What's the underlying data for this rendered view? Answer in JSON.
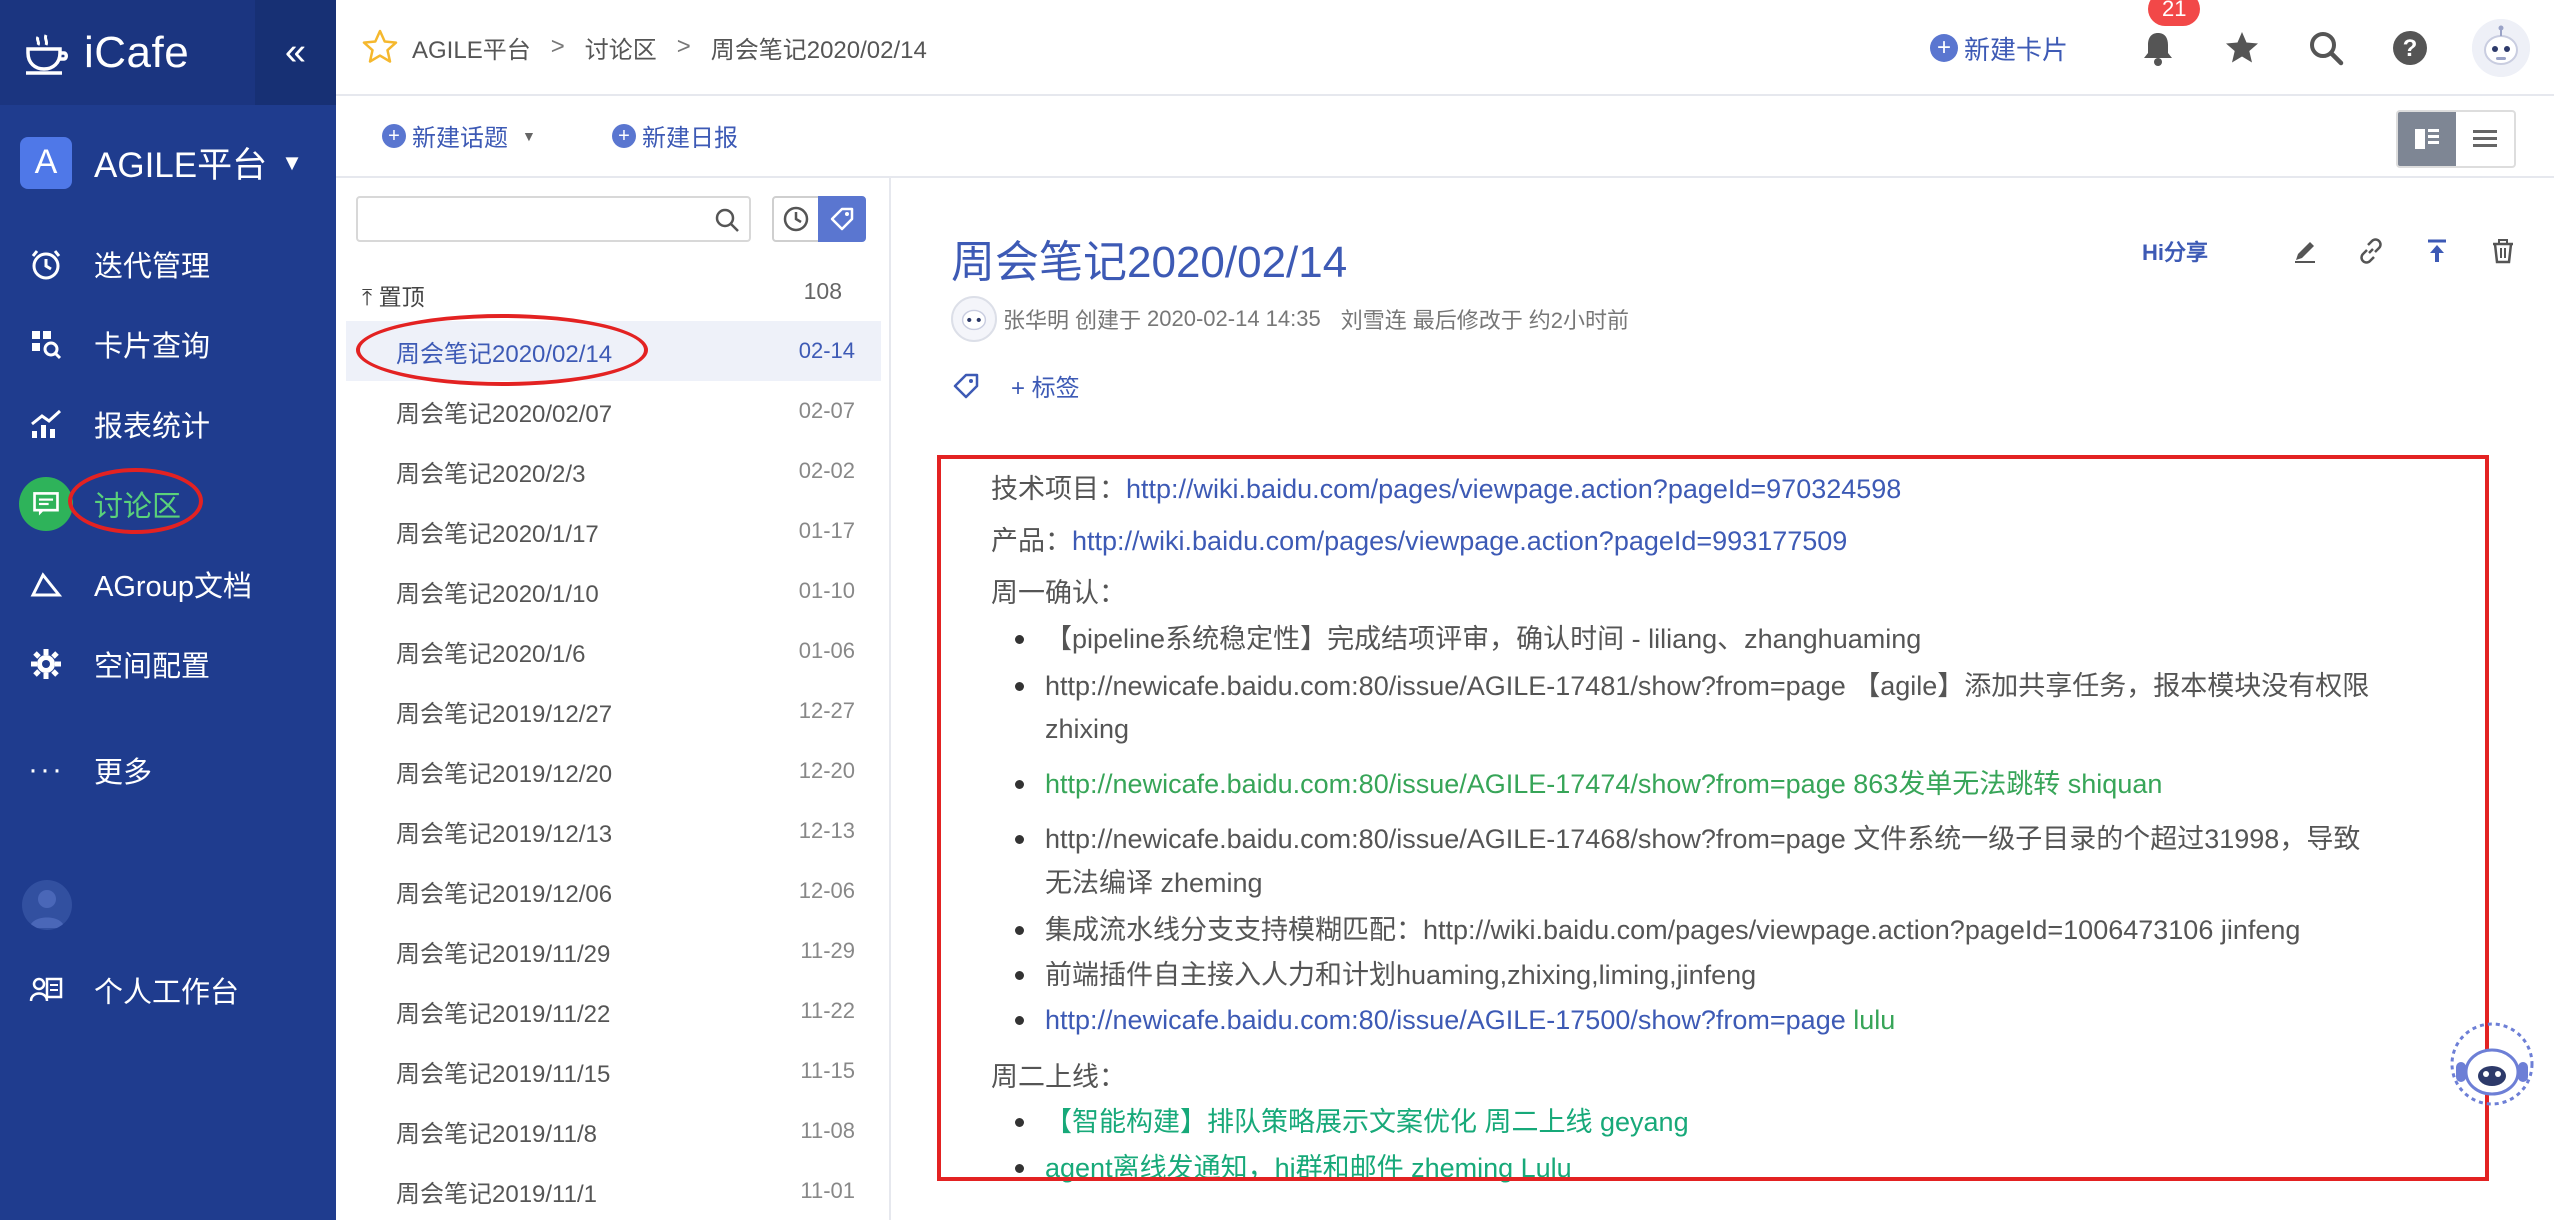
{
  "app": {
    "name": "iCafe",
    "collapse_glyph": "«"
  },
  "space": {
    "initial": "A",
    "name": "AGILE平台"
  },
  "nav": [
    {
      "label": "迭代管理",
      "icon": "iteration-icon"
    },
    {
      "label": "卡片查询",
      "icon": "card-search-icon"
    },
    {
      "label": "报表统计",
      "icon": "chart-icon"
    },
    {
      "label": "讨论区",
      "icon": "discussion-icon",
      "active": true
    },
    {
      "label": "AGroup文档",
      "icon": "document-icon"
    },
    {
      "label": "空间配置",
      "icon": "gear-icon"
    },
    {
      "label": "更多",
      "icon": "more-icon"
    },
    {
      "label": "个人工作台",
      "icon": "workbench-icon"
    }
  ],
  "breadcrumb": [
    "AGILE平台",
    "讨论区",
    "周会笔记2020/02/14"
  ],
  "breadcrumb_sep": ">",
  "header": {
    "new_card": "新建卡片",
    "notification_count": "21"
  },
  "toolbar": {
    "new_topic": "新建话题",
    "new_daily": "新建日报"
  },
  "list": {
    "search_placeholder": "",
    "pinned_label": "置顶",
    "pinned_count": "108",
    "items": [
      {
        "title": "周会笔记2020/02/14",
        "date": "02-14"
      },
      {
        "title": "周会笔记2020/02/07",
        "date": "02-07"
      },
      {
        "title": "周会笔记2020/2/3",
        "date": "02-02"
      },
      {
        "title": "周会笔记2020/1/17",
        "date": "01-17"
      },
      {
        "title": "周会笔记2020/1/10",
        "date": "01-10"
      },
      {
        "title": "周会笔记2020/1/6",
        "date": "01-06"
      },
      {
        "title": "周会笔记2019/12/27",
        "date": "12-27"
      },
      {
        "title": "周会笔记2019/12/20",
        "date": "12-20"
      },
      {
        "title": "周会笔记2019/12/13",
        "date": "12-13"
      },
      {
        "title": "周会笔记2019/12/06",
        "date": "12-06"
      },
      {
        "title": "周会笔记2019/11/29",
        "date": "11-29"
      },
      {
        "title": "周会笔记2019/11/22",
        "date": "11-22"
      },
      {
        "title": "周会笔记2019/11/15",
        "date": "11-15"
      },
      {
        "title": "周会笔记2019/11/8",
        "date": "11-08"
      },
      {
        "title": "周会笔记2019/11/1",
        "date": "11-01"
      }
    ]
  },
  "detail": {
    "title": "周会笔记2020/02/14",
    "share": "Hi分享",
    "author": "张华明",
    "created_label": "创建于",
    "created_at": "2020-02-14 14:35",
    "modifier": "刘雪连",
    "modified_label": "最后修改于",
    "modified_at": "约2小时前",
    "add_tag": "+ 标签",
    "tech_label": "技术项目：",
    "tech_link": "http://wiki.baidu.com/pages/viewpage.action?pageId=970324598",
    "product_label": "产品：",
    "product_link": "http://wiki.baidu.com/pages/viewpage.action?pageId=993177509",
    "monday_heading": "周一确认：",
    "m1": "【pipeline系统稳定性】完成结项评审，确认时间 - liliang、zhanghuaming",
    "m2": "http://newicafe.baidu.com:80/issue/AGILE-17481/show?from=page 【agile】添加共享任务，报本模块没有权限 zhixing",
    "m3": "http://newicafe.baidu.com:80/issue/AGILE-17474/show?from=page 863发单无法跳转 shiquan",
    "m4": "http://newicafe.baidu.com:80/issue/AGILE-17468/show?from=page 文件系统一级子目录的个超过31998，导致无法编译 zheming",
    "m5": "集成流水线分支支持模糊匹配：http://wiki.baidu.com/pages/viewpage.action?pageId=1006473106 jinfeng",
    "m6": "前端插件自主接入人力和计划huaming,zhixing,liming,jinfeng",
    "m7_link": "http://newicafe.baidu.com:80/issue/AGILE-17500/show?from=page",
    "m7_name": " lulu",
    "tuesday_heading": "周二上线：",
    "t1": "【智能构建】排队策略展示文案优化 周二上线 geyang",
    "t2": "agent离线发通知，hi群和邮件 zheming Lulu"
  },
  "colors": {
    "sidebar": "#1f3c8e",
    "accent": "#3d5ab5",
    "active_green": "#2eb35a",
    "annotation_red": "#e32222",
    "badge_red": "#f24848"
  }
}
